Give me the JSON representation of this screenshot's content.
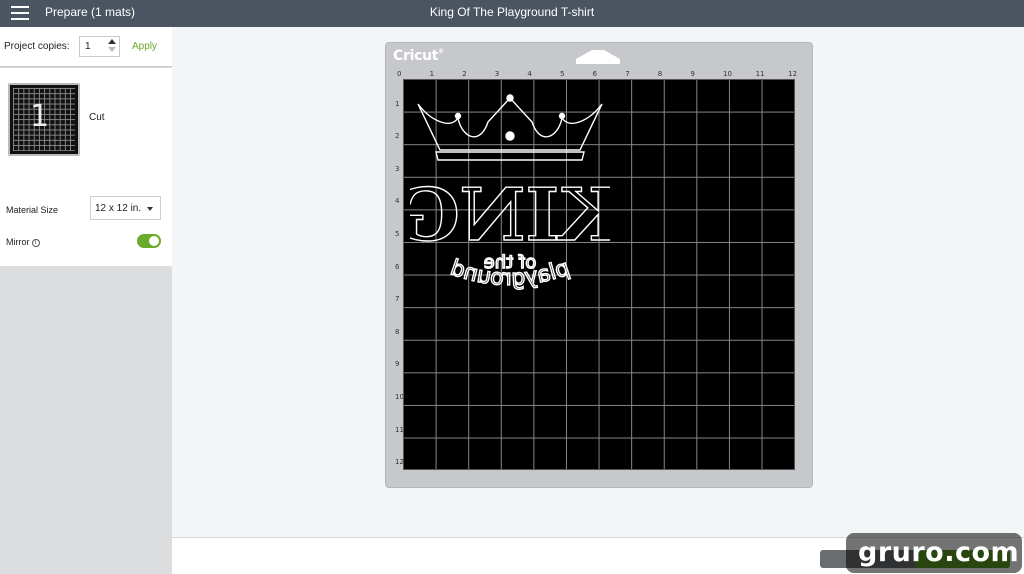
{
  "topbar": {
    "left_title": "Prepare (1 mats)",
    "project_title": "King Of The Playground T-shirt"
  },
  "sidebar": {
    "copies_label": "Project copies:",
    "copies_value": "1",
    "apply_label": "Apply",
    "mat_number": "1",
    "mat_label": "Cut",
    "material_size_label": "Material Size",
    "material_size_value": "12 x 12 in.",
    "mirror_label": "Mirror",
    "mirror_on": true
  },
  "mat": {
    "logo_text": "Cricut",
    "ruler_x": [
      "0",
      "1",
      "2",
      "3",
      "4",
      "5",
      "6",
      "7",
      "8",
      "9",
      "10",
      "11",
      "12"
    ],
    "ruler_y": [
      "1",
      "2",
      "3",
      "4",
      "5",
      "6",
      "7",
      "8",
      "9",
      "10",
      "11",
      "12"
    ],
    "design_text": {
      "main": "KING",
      "middle": "of the",
      "bottom": "playground"
    }
  },
  "watermark": {
    "text": "gruro.com"
  },
  "colors": {
    "accent_green": "#6aab2b",
    "topbar": "#4a5561",
    "mat_frame": "#c6c8cb"
  }
}
